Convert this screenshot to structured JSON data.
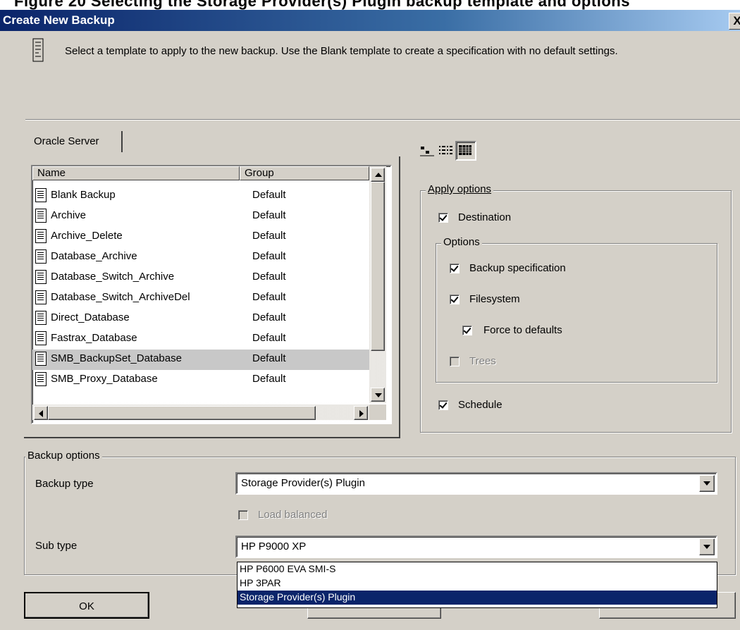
{
  "window": {
    "title": "Create New Backup",
    "close_label": "X"
  },
  "top_strip_text": "Figure 20 Selecting the Storage Provider(s) Plugin backup template and options",
  "intro": {
    "text": "Select a template to apply to the new backup. Use the Blank template to create a specification with no default settings."
  },
  "template_tab": {
    "label": "Oracle Server"
  },
  "list": {
    "columns": [
      "Name",
      "Group"
    ],
    "rows": [
      {
        "name": "Blank Backup",
        "group": "Default"
      },
      {
        "name": "Archive",
        "group": "Default"
      },
      {
        "name": "Archive_Delete",
        "group": "Default"
      },
      {
        "name": "Database_Archive",
        "group": "Default"
      },
      {
        "name": "Database_Switch_Archive",
        "group": "Default"
      },
      {
        "name": "Database_Switch_ArchiveDel",
        "group": "Default"
      },
      {
        "name": "Direct_Database",
        "group": "Default"
      },
      {
        "name": "Fastrax_Database",
        "group": "Default"
      },
      {
        "name": "SMB_BackupSet_Database",
        "group": "Default",
        "selected": true
      },
      {
        "name": "SMB_Proxy_Database",
        "group": "Default"
      }
    ]
  },
  "apply_options": {
    "legend": "Apply options",
    "destination": {
      "label": "Destination",
      "checked": true
    },
    "options_group": {
      "legend": "Options",
      "backup_specification": {
        "label": "Backup specification",
        "checked": true
      },
      "filesystem": {
        "label": "Filesystem",
        "checked": true
      },
      "force_to_defaults": {
        "label": "Force to defaults",
        "checked": true
      },
      "trees": {
        "label": "Trees",
        "checked": false,
        "disabled": true
      }
    },
    "schedule": {
      "label": "Schedule",
      "checked": true
    }
  },
  "backup_options": {
    "legend": "Backup options",
    "backup_type_label": "Backup type",
    "backup_type_value": "Storage Provider(s) Plugin",
    "load_balanced": {
      "label": "Load balanced",
      "checked": false,
      "disabled": true
    },
    "sub_type_label": "Sub type",
    "sub_type_value": "HP P9000 XP",
    "sub_type_dropdown": [
      {
        "label": "HP P6000 EVA SMI-S"
      },
      {
        "label": "HP 3PAR"
      },
      {
        "label": "Storage Provider(s) Plugin",
        "highlighted": true
      }
    ]
  },
  "buttons": {
    "ok": "OK"
  }
}
